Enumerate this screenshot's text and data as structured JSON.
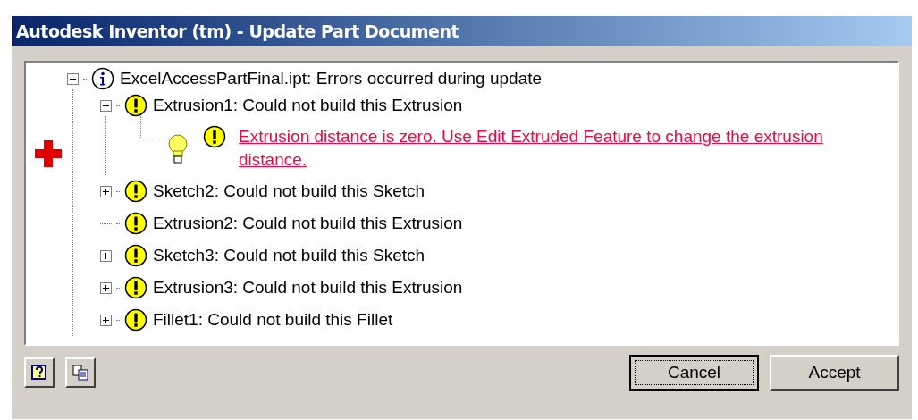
{
  "window": {
    "title": "Autodesk Inventor (tm) - Update Part Document"
  },
  "tree": [
    {
      "kind": "info",
      "label": "ExcelAccessPartFinal.ipt: Errors occurred during update",
      "expanded": true,
      "children": [
        {
          "kind": "warning",
          "label": "Extrusion1: Could not build this Extrusion",
          "expanded": true,
          "children": [
            {
              "kind": "message",
              "label": "Extrusion distance is zero.  Use Edit Extruded Feature to change the extrusion distance."
            }
          ]
        },
        {
          "kind": "warning",
          "label": "Sketch2: Could not build this Sketch",
          "expanded": false
        },
        {
          "kind": "warning",
          "label": "Extrusion2: Could not build this Extrusion"
        },
        {
          "kind": "warning",
          "label": "Sketch3: Could not build this Sketch",
          "expanded": false
        },
        {
          "kind": "warning",
          "label": "Extrusion3: Could not build this Extrusion",
          "expanded": false
        },
        {
          "kind": "warning",
          "label": "Fillet1: Could not build this Fillet",
          "expanded": false
        }
      ]
    }
  ],
  "buttons": [
    {
      "label": "Cancel",
      "default": true
    },
    {
      "label": "Accept",
      "default": false
    }
  ]
}
